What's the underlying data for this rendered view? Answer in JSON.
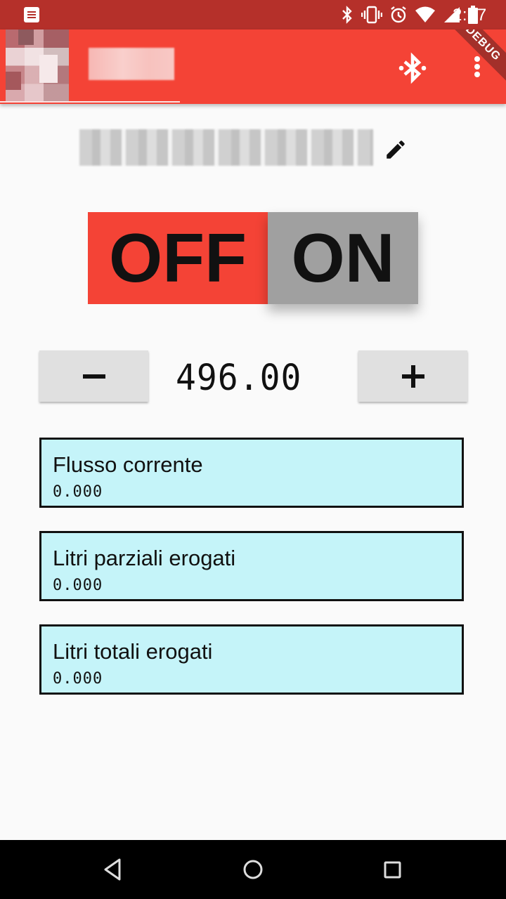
{
  "status_bar": {
    "time": "2:07",
    "icons": [
      "notification-icon",
      "bluetooth-icon",
      "vibrate-icon",
      "alarm-icon",
      "wifi-icon",
      "signal-icon",
      "battery-icon"
    ]
  },
  "app_bar": {
    "title": "",
    "debug_banner": "DEBUG",
    "accent_color": "#f44336"
  },
  "device": {
    "name": ""
  },
  "toggle": {
    "off_label": "OFF",
    "on_label": "ON",
    "selected": "OFF"
  },
  "stepper": {
    "minus_label": "−",
    "plus_label": "+",
    "value": "496.00"
  },
  "readouts": [
    {
      "label": "Flusso corrente",
      "value": "0.000"
    },
    {
      "label": "Litri parziali erogati",
      "value": "0.000"
    },
    {
      "label": "Litri totali erogati",
      "value": "0.000"
    }
  ],
  "colors": {
    "card_background": "#c5f4f9",
    "off_active": "#f44336",
    "on_inactive": "#a0a0a0"
  }
}
